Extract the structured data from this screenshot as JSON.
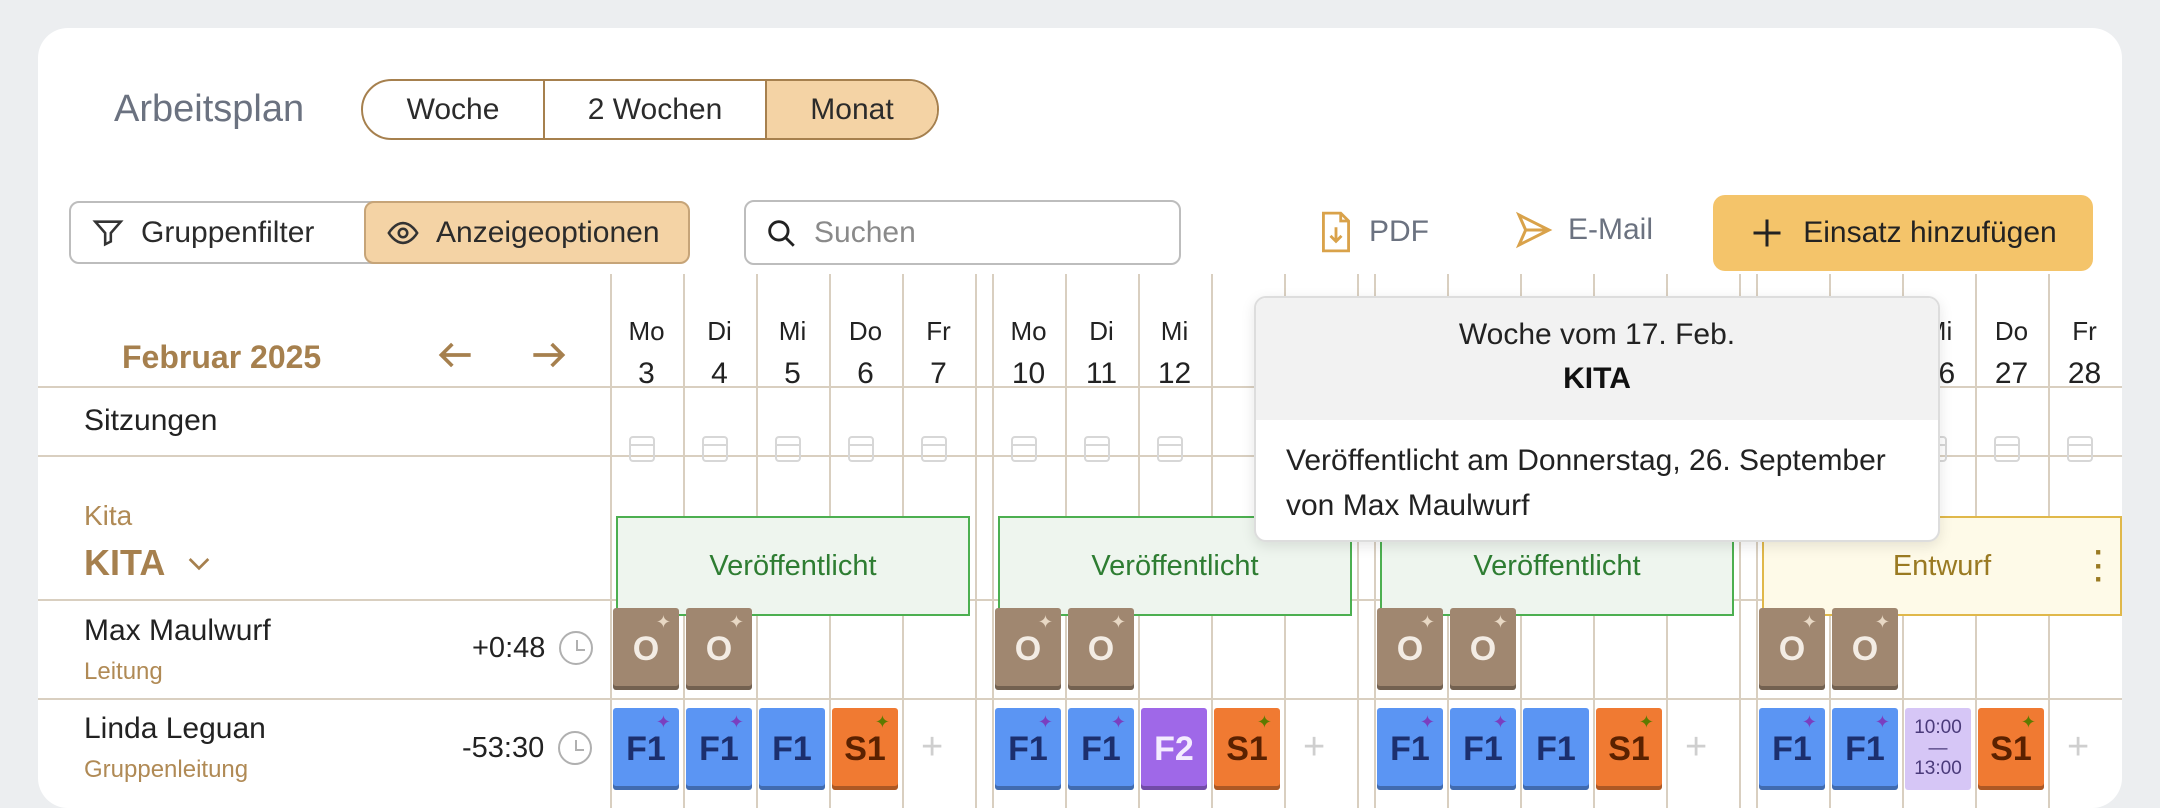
{
  "header": {
    "title": "Arbeitsplan",
    "view_tabs": [
      {
        "label": "Woche",
        "active": false
      },
      {
        "label": "2 Wochen",
        "active": false
      },
      {
        "label": "Monat",
        "active": true
      }
    ]
  },
  "toolbar": {
    "group_filter": "Gruppenfilter",
    "display_options": "Anzeigeoptionen",
    "search_placeholder": "Suchen",
    "pdf": "PDF",
    "email": "E-Mail",
    "add_shift": "Einsatz hinzufügen"
  },
  "calendar": {
    "month_label": "Februar 2025",
    "days": [
      {
        "name": "Mo",
        "num": "3"
      },
      {
        "name": "Di",
        "num": "4"
      },
      {
        "name": "Mi",
        "num": "5"
      },
      {
        "name": "Do",
        "num": "6"
      },
      {
        "name": "Fr",
        "num": "7"
      },
      {
        "name": "Mo",
        "num": "10"
      },
      {
        "name": "Di",
        "num": "11"
      },
      {
        "name": "Mi",
        "num": "12"
      },
      {
        "name": "Mi",
        "num": "26"
      },
      {
        "name": "Do",
        "num": "27"
      },
      {
        "name": "Fr",
        "num": "28"
      }
    ],
    "sessions_label": "Sitzungen"
  },
  "group": {
    "label": "Kita",
    "name": "KITA",
    "week_status": [
      "Veröffentlicht",
      "Veröffentlicht",
      "Veröffentlicht",
      "Entwurf"
    ]
  },
  "employees": [
    {
      "name": "Max Maulwurf",
      "role": "Leitung",
      "balance": "+0:48"
    },
    {
      "name": "Linda Leguan",
      "role": "Gruppenleitung",
      "balance": "-53:30"
    }
  ],
  "shift_codes": {
    "o": "O",
    "f1": "F1",
    "f2": "F2",
    "s1": "S1",
    "time_start": "10:00",
    "time_sep": "—",
    "time_end": "13:00"
  },
  "tooltip": {
    "title": "Woche vom 17. Feb.",
    "group": "KITA",
    "line1": "Veröffentlicht am Donnerstag, 26. September",
    "line2": "von Max Maulwurf"
  },
  "colors": {
    "accent": "#a6804e",
    "primary_button": "#f4c46a",
    "published": "#4caf50",
    "draft": "#e0b84a"
  },
  "icons": [
    "funnel-icon",
    "eye-icon",
    "search-icon",
    "pdf-download-icon",
    "send-icon",
    "plus-icon",
    "arrow-left-icon",
    "arrow-right-icon",
    "chevron-down-icon",
    "clock-icon",
    "calendar-icon",
    "kebab-menu-icon",
    "sparkle-icon"
  ]
}
